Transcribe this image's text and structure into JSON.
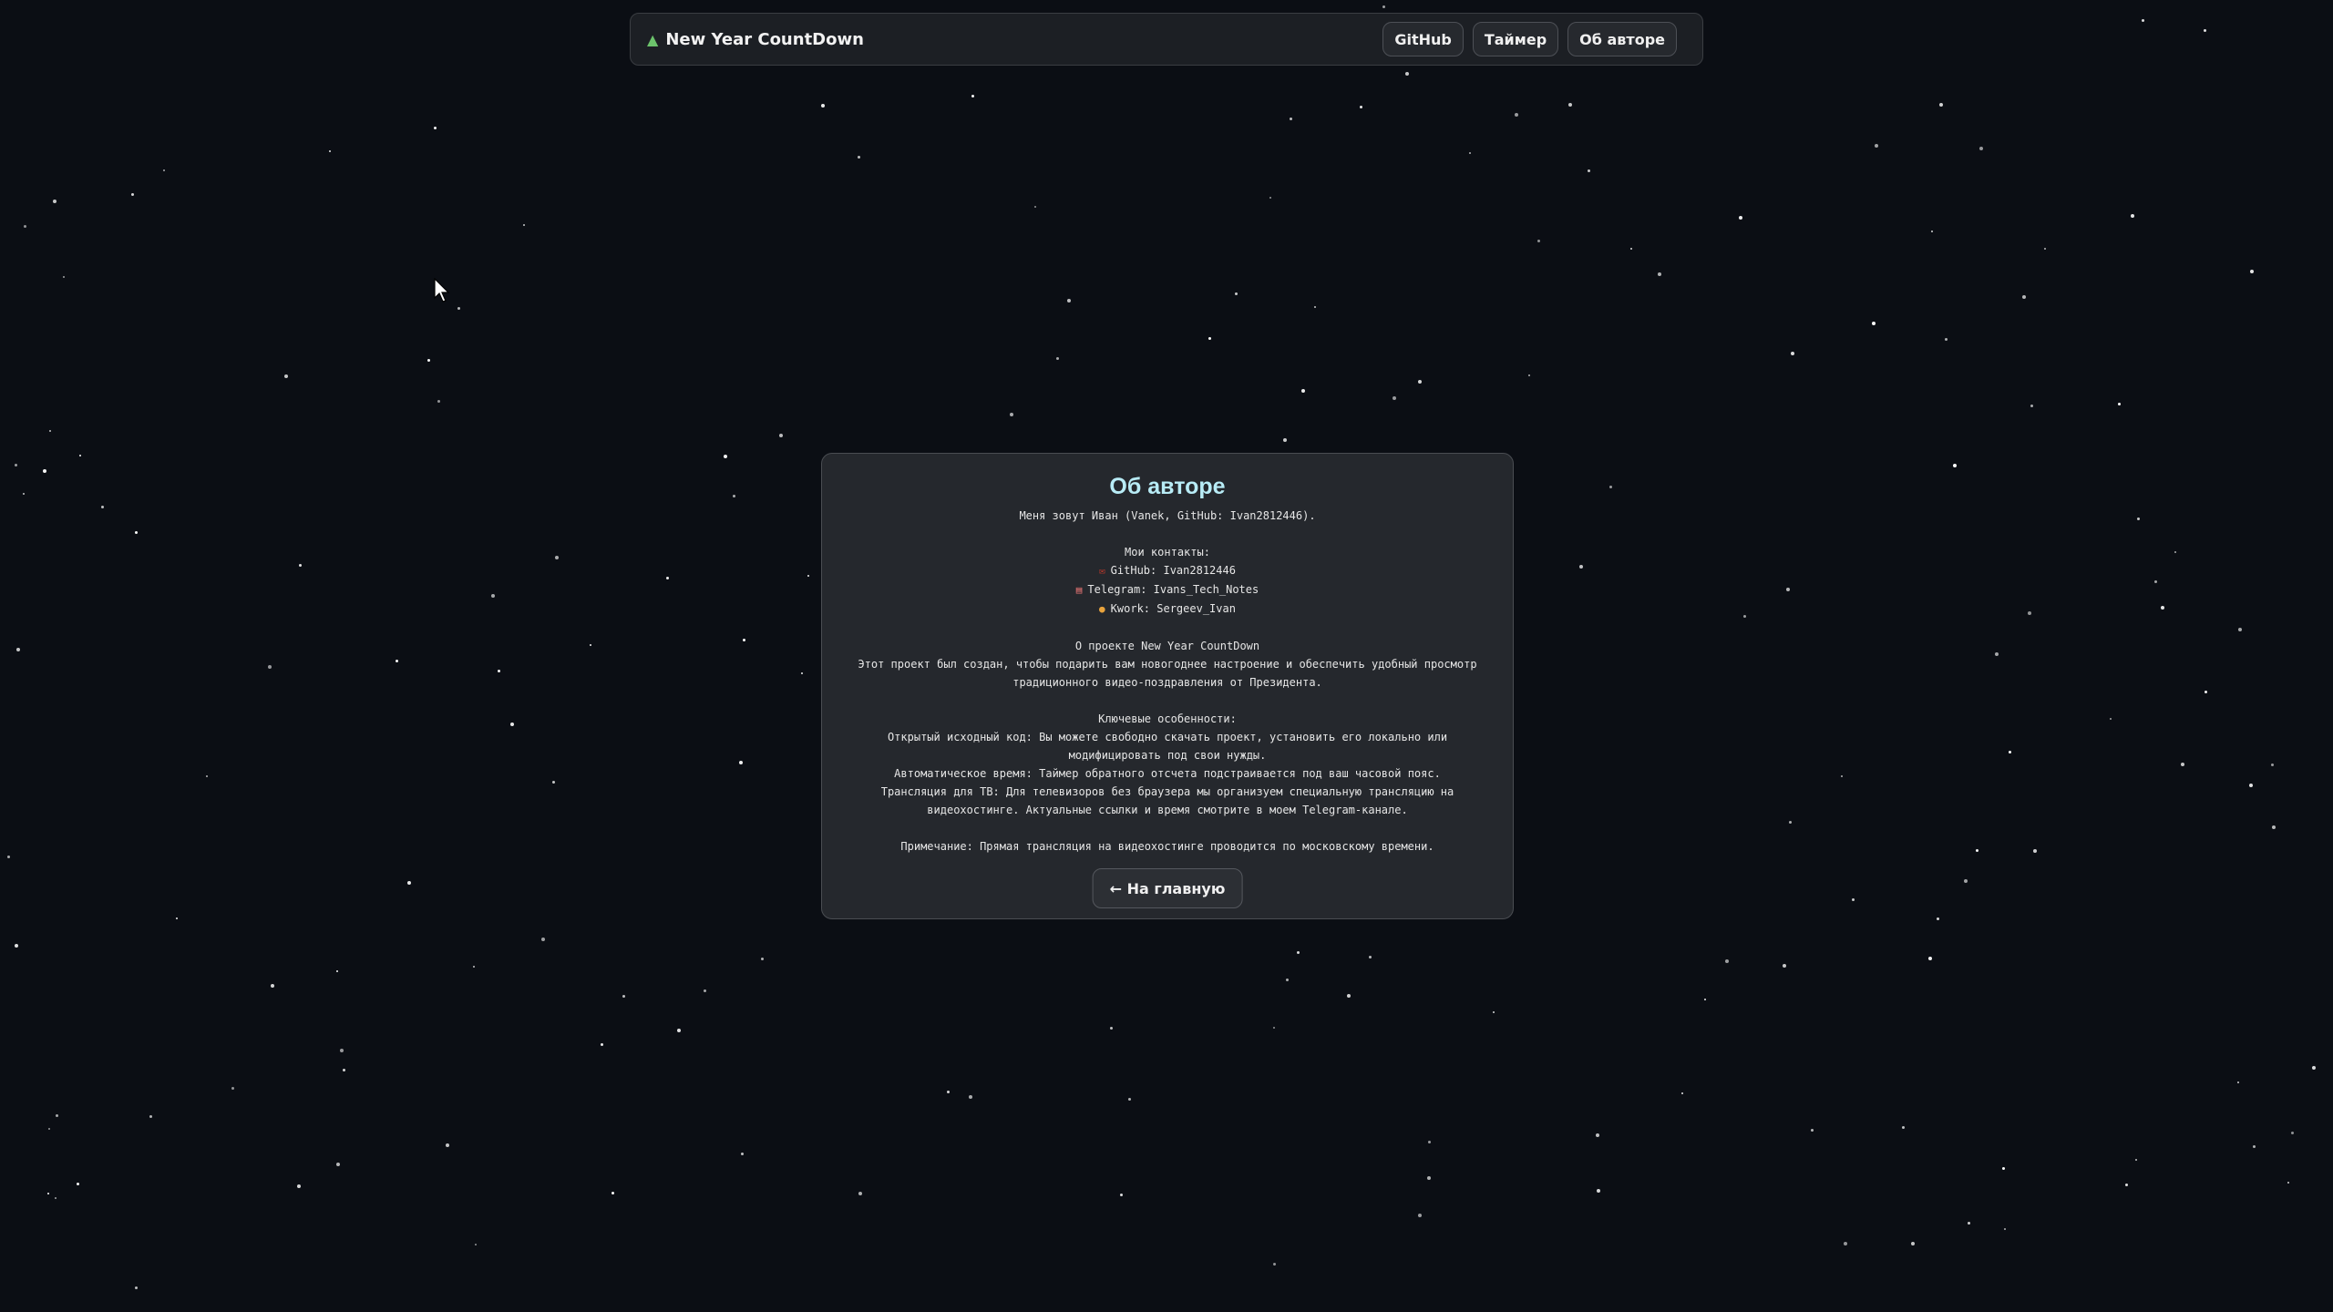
{
  "brand": {
    "icon": "christmas-tree-icon",
    "title": "New Year CountDown"
  },
  "nav": {
    "github": "GitHub",
    "timer": "Таймер",
    "about": "Об авторе"
  },
  "about": {
    "heading": "Об авторе",
    "intro": "Меня зовут Иван (Vanek, GitHub: Ivan2812446).",
    "contacts_title": "Мои контакты:",
    "contacts": [
      {
        "icon": "mailbox-icon",
        "text": "GitHub: Ivan2812446"
      },
      {
        "icon": "notebook-icon",
        "text": "Telegram: Ivans_Tech_Notes"
      },
      {
        "icon": "moneybag-icon",
        "text": "Kwork: Sergeev_Ivan"
      }
    ],
    "project_title": "О проекте New Year CountDown",
    "project_text": "Этот проект был создан, чтобы подарить вам новогоднее настроение и обеспечить удобный просмотр традиционного видео-поздравления от Президента.",
    "features_title": "Ключевые особенности:",
    "features": [
      "Открытый исходный код: Вы можете свободно скачать проект, установить его локально или модифицировать под свои нужды.",
      "Автоматическое время: Таймер обратного отсчета подстраивается под ваш часовой пояс.",
      "Трансляция для ТВ: Для телевизоров без браузера мы организуем специальную трансляцию на видеохостинге. Актуальные ссылки и время смотрите в моем Telegram-канале."
    ],
    "note": "Примечание: Прямая трансляция на видеохостинге проводится по московскому времени.",
    "back_button": "← На главную"
  },
  "colors": {
    "background": "#0b0e14",
    "heading": "#b8ecf6",
    "card": "#25282d"
  }
}
